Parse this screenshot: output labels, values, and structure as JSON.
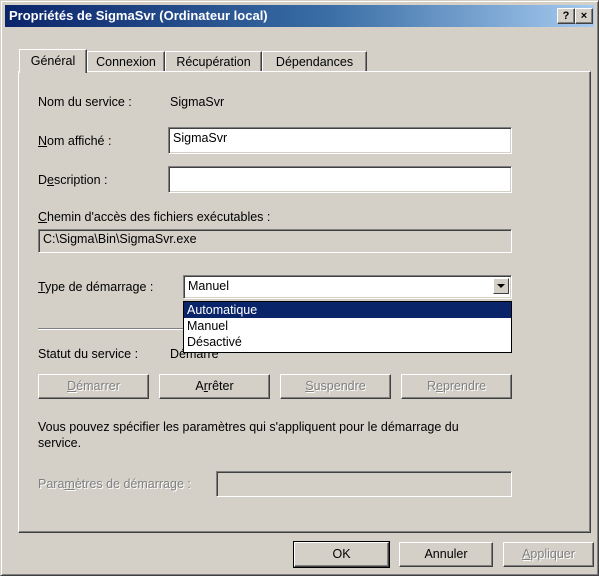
{
  "window": {
    "title": "Propriétés de SigmaSvr (Ordinateur local)",
    "help_button": "?",
    "close_button": "×"
  },
  "tabs": [
    {
      "label": "Général"
    },
    {
      "label": "Connexion"
    },
    {
      "label": "Récupération"
    },
    {
      "label": "Dépendances"
    }
  ],
  "general": {
    "service_name_label": "Nom du service :",
    "service_name_value": "SigmaSvr",
    "display_name_label": "Nom affiché :",
    "display_name_value": "SigmaSvr",
    "description_label": "Description :",
    "description_value": "",
    "exe_path_label": "Chemin d'accès des fichiers exécutables :",
    "exe_path_value": "C:\\Sigma\\Bin\\SigmaSvr.exe",
    "startup_type_label": "Type de démarrage :",
    "startup_type_value": "Manuel",
    "startup_options": [
      {
        "label": "Automatique"
      },
      {
        "label": "Manuel"
      },
      {
        "label": "Désactivé"
      }
    ],
    "highlighted_option": "Automatique",
    "status_label": "Statut du service :",
    "status_value": "Démarré",
    "buttons": {
      "start": "Démarrer",
      "stop": "Arrêter",
      "pause": "Suspendre",
      "resume": "Reprendre"
    },
    "hint_line1": "Vous pouvez spécifier les paramètres qui s'appliquent pour le démarrage du",
    "hint_line2": "service.",
    "params_label": "Paramètres de démarrage :",
    "params_value": ""
  },
  "footer": {
    "ok": "OK",
    "cancel": "Annuler",
    "apply": "Appliquer"
  },
  "colors": {
    "titlebar_start": "#0a246a",
    "titlebar_end": "#a6caf0",
    "face": "#d4d0c8",
    "selection": "#0a246a"
  }
}
